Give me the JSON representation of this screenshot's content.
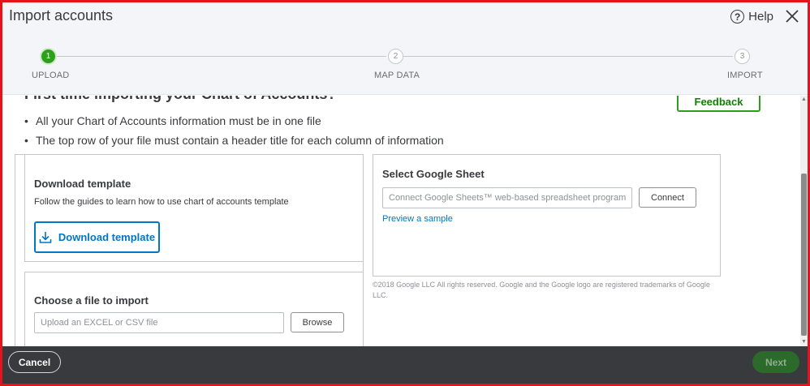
{
  "dialog": {
    "title": "Import accounts",
    "help_label": "Help",
    "help_glyph": "?"
  },
  "stepper": {
    "steps": [
      {
        "number": "1",
        "label": "UPLOAD",
        "state": "active"
      },
      {
        "number": "2",
        "label": "MAP DATA",
        "state": "inactive"
      },
      {
        "number": "3",
        "label": "IMPORT",
        "state": "inactive"
      }
    ]
  },
  "main": {
    "heading": "First time importing your Chart of Accounts?",
    "feedback_label": "Feedback",
    "bullets": [
      "All your Chart of Accounts information must be in one file",
      "The top row of your file must contain a header title for each column of information"
    ]
  },
  "download_template": {
    "title": "Download template",
    "description": "Follow the guides to learn how to use chart of accounts template",
    "button_label": "Download template"
  },
  "choose_file": {
    "title": "Choose a file to import",
    "placeholder": "Upload an EXCEL or CSV file",
    "browse_label": "Browse"
  },
  "google_sheet": {
    "title": "Select Google Sheet",
    "placeholder": "Connect Google Sheets™ web-based spreadsheet program",
    "connect_label": "Connect",
    "preview_link": "Preview a sample",
    "legal": "©2018 Google LLC All rights reserved. Google and the Google logo are registered trademarks of Google LLC."
  },
  "footer": {
    "cancel_label": "Cancel",
    "next_label": "Next"
  },
  "colors": {
    "accent_green": "#2ca01c",
    "link_blue": "#0077c5",
    "footer_bg": "#393a3d",
    "frame_red": "#e3141b"
  },
  "icons": [
    "help-icon",
    "close-icon",
    "download-icon",
    "scroll-up-icon",
    "scroll-down-icon"
  ]
}
